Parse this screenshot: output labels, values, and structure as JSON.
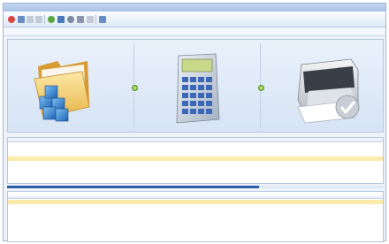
{
  "colors": {
    "accent": "#2f5ea8",
    "selection": "#fbeaa8",
    "panel_bg": "#e2ecf8",
    "arrow": "#7cb332"
  },
  "toolbar": {
    "buttons": [
      {
        "name": "record-icon",
        "color": "#d9463b"
      },
      {
        "name": "settings-icon",
        "color": "#6a8ec4"
      },
      {
        "name": "help-icon",
        "color": "#9aa7b8"
      },
      {
        "name": "copy-icon",
        "color": "#9aa7b8"
      },
      {
        "name": "refresh-icon",
        "color": "#58a83c"
      },
      {
        "name": "database-icon",
        "color": "#4a79b8"
      },
      {
        "name": "search-icon",
        "color": "#7d8aa0"
      },
      {
        "name": "user-icon",
        "color": "#8a97ad"
      },
      {
        "name": "document-icon",
        "color": "#9aa7b8"
      },
      {
        "name": "info-icon",
        "color": "#6a8ec4"
      }
    ]
  },
  "workflow": {
    "steps": [
      {
        "icon": "folder-icon"
      },
      {
        "icon": "calculator-icon"
      },
      {
        "icon": "printer-icon"
      }
    ]
  },
  "grid": {
    "rows": [
      {
        "selected": false
      },
      {
        "selected": false
      },
      {
        "selected": false
      },
      {
        "selected": true
      }
    ]
  },
  "progress": {
    "value": 0.67
  },
  "lower": {
    "rows": [
      {
        "selected": true
      }
    ]
  }
}
